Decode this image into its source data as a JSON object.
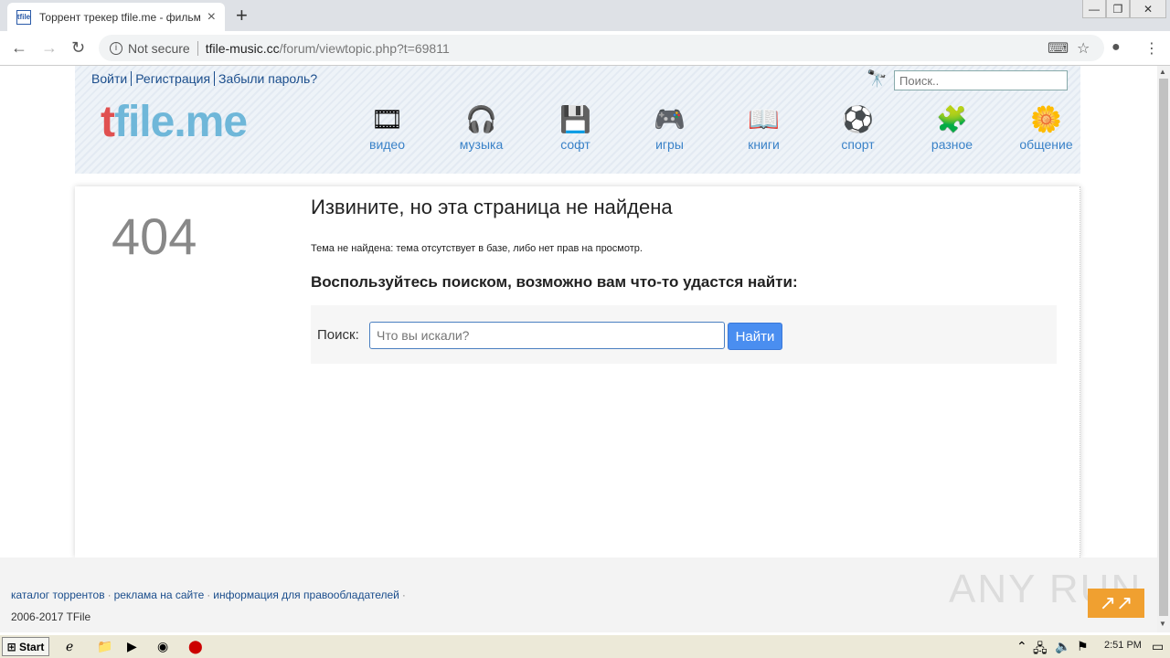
{
  "browser": {
    "tab_title": "Торрент трекер tfile.me - фильмы,",
    "favicon_text": "tfile",
    "not_secure": "Not secure",
    "url_host": "tfile-music.cc",
    "url_path": "/forum/viewtopic.php?t=69811"
  },
  "site": {
    "toplinks": [
      "Войти",
      "Регистрация",
      "Забыли пароль?"
    ],
    "header_search_placeholder": "Поиск..",
    "logo_t": "t",
    "logo_rest": "file.me",
    "categories": [
      {
        "label": "видео",
        "icon": "🎞"
      },
      {
        "label": "музыка",
        "icon": "🎧"
      },
      {
        "label": "софт",
        "icon": "💾"
      },
      {
        "label": "игры",
        "icon": "🎮"
      },
      {
        "label": "книги",
        "icon": "📖"
      },
      {
        "label": "спорт",
        "icon": "⚽"
      },
      {
        "label": "разное",
        "icon": "🧩"
      },
      {
        "label": "общение",
        "icon": "🌼"
      }
    ]
  },
  "error": {
    "code": "404",
    "title": "Извините, но эта страница не найдена",
    "description": "Тема не найдена: тема отсутствует в базе, либо нет прав на просмотр.",
    "hint": "Воспользуйтесь поиском, возможно вам что-то удастся найти:",
    "search_label": "Поиск:",
    "search_placeholder": "Что вы искали?",
    "search_button": "Найти"
  },
  "footer": {
    "links": [
      "каталог торрентов",
      "реклама на сайте",
      "информация для правообладателей"
    ],
    "copyright": "2006-2017 TFile",
    "watermark": "ANY RUN"
  },
  "taskbar": {
    "start": "Start",
    "clock": "2:51 PM"
  }
}
